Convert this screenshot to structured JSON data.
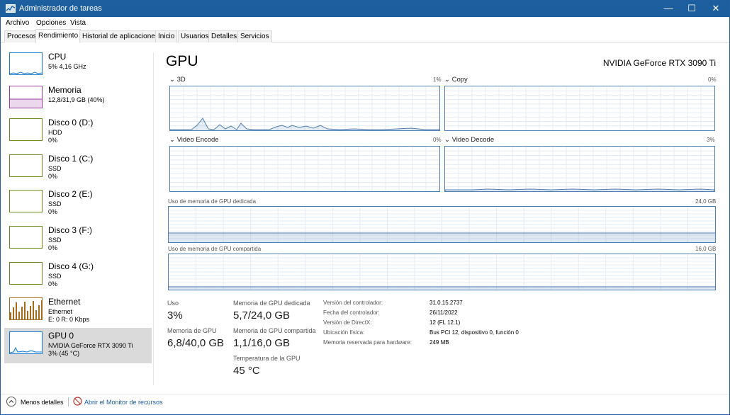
{
  "titlebar": {
    "title": "Administrador de tareas",
    "min": "—",
    "max": "☐",
    "close": "✕"
  },
  "menu": [
    "Archivo",
    "Opciones",
    "Vista"
  ],
  "tabs": [
    "Procesos",
    "Rendimiento",
    "Historial de aplicaciones",
    "Inicio",
    "Usuarios",
    "Detalles",
    "Servicios"
  ],
  "sidebar": [
    {
      "name": "CPU",
      "line1": "5% 4,16 GHz",
      "line2": "",
      "line3": "",
      "color": "#1a7ad0",
      "icon": "cpu-graph"
    },
    {
      "name": "Memoria",
      "line1": "12,8/31,9 GB (40%)",
      "line2": "",
      "line3": "",
      "color": "#9b3aa0",
      "icon": "memory-graph"
    },
    {
      "name": "Disco 0 (D:)",
      "line1": "HDD",
      "line2": "0%",
      "line3": "",
      "color": "#6c8a1d",
      "icon": "disk-graph"
    },
    {
      "name": "Disco 1 (C:)",
      "line1": "SSD",
      "line2": "0%",
      "line3": "",
      "color": "#6c8a1d",
      "icon": "disk-graph"
    },
    {
      "name": "Disco 2 (E:)",
      "line1": "SSD",
      "line2": "0%",
      "line3": "",
      "color": "#6c8a1d",
      "icon": "disk-graph"
    },
    {
      "name": "Disco 3 (F:)",
      "line1": "SSD",
      "line2": "0%",
      "line3": "",
      "color": "#6c8a1d",
      "icon": "disk-graph"
    },
    {
      "name": "Disco 4 (G:)",
      "line1": "SSD",
      "line2": "0%",
      "line3": "",
      "color": "#6c8a1d",
      "icon": "disk-graph"
    },
    {
      "name": "Ethernet",
      "line1": "Ethernet",
      "line2": "E: 0 R: 0 Kbps",
      "line3": "",
      "color": "#a56a1a",
      "icon": "network-graph"
    },
    {
      "name": "GPU 0",
      "line1": "NVIDIA GeForce RTX 3090 Ti",
      "line2": "3% (45 °C)",
      "line3": "",
      "color": "#1a7ad0",
      "icon": "gpu-graph"
    }
  ],
  "main": {
    "title": "GPU",
    "model": "NVIDIA GeForce RTX 3090 Ti",
    "graphs": {
      "g3d": {
        "label": "3D",
        "pct": "1%"
      },
      "copy": {
        "label": "Copy",
        "pct": "0%"
      },
      "encode": {
        "label": "Video Encode",
        "pct": "0%"
      },
      "decode": {
        "label": "Video Decode",
        "pct": "3%"
      },
      "dedicated": {
        "label": "Uso de memoria de GPU dedicada",
        "max": "24,0 GB"
      },
      "shared": {
        "label": "Uso de memoria de GPU compartida",
        "max": "16,0 GB"
      }
    },
    "stats": {
      "uso_label": "Uso",
      "uso": "3%",
      "mem_label": "Memoria de GPU",
      "mem": "6,8/40,0 GB",
      "ded_label": "Memoria de GPU dedicada",
      "ded": "5,7/24,0 GB",
      "sha_label": "Memoria de GPU compartida",
      "sha": "1,1/16,0 GB",
      "temp_label": "Temperatura de la GPU",
      "temp": "45 °C"
    },
    "info": [
      {
        "key": "Versión del controlador:",
        "val": "31.0.15.2737"
      },
      {
        "key": "Fecha del controlador:",
        "val": "26/11/2022"
      },
      {
        "key": "Versión de DirectX:",
        "val": "12 (FL 12.1)"
      },
      {
        "key": "Ubicación física:",
        "val": "Bus PCI 12, dispositivo 0, función 0"
      },
      {
        "key": "Memoria reservada para hardware:",
        "val": "249 MB"
      }
    ]
  },
  "footer": {
    "less": "Menos detalles",
    "monitor": "Abrir el Monitor de recursos"
  }
}
